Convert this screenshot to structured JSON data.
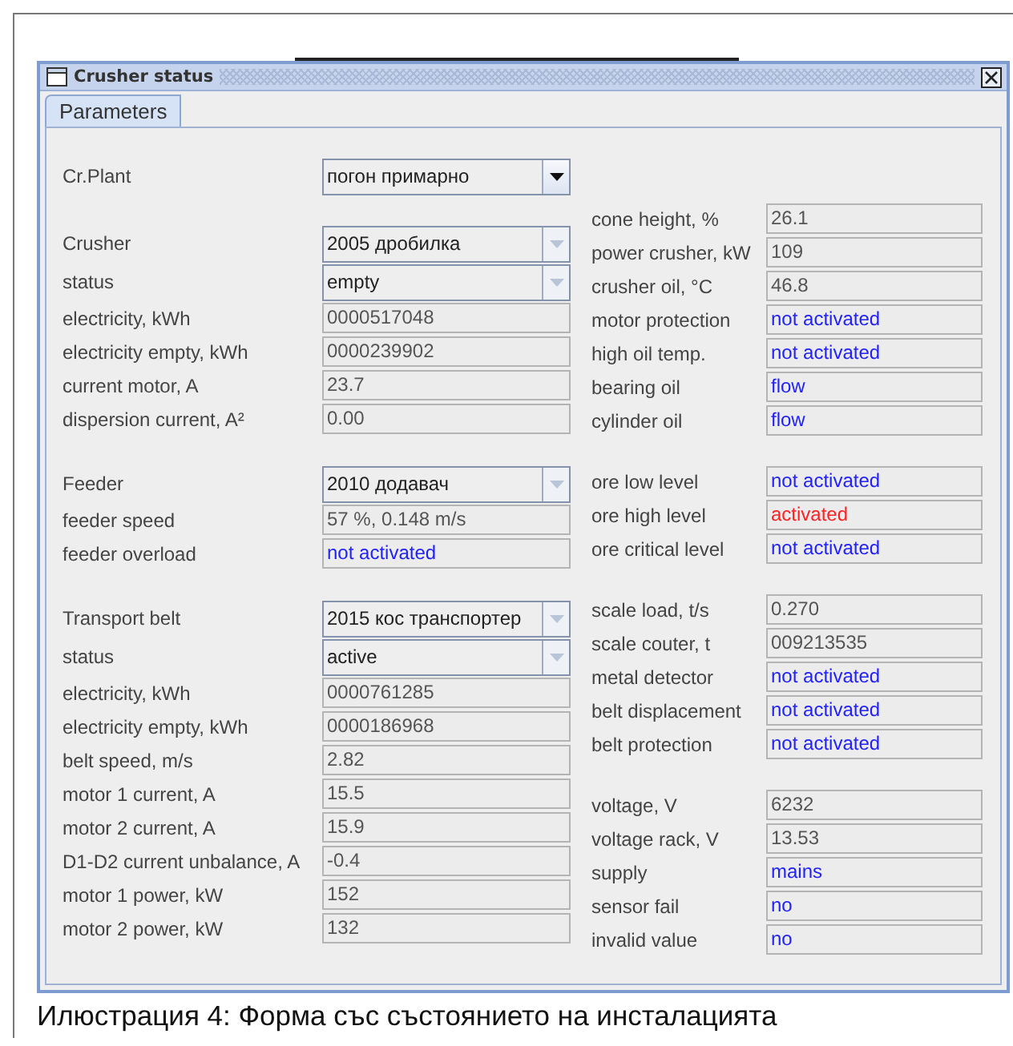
{
  "window": {
    "title": "Crusher status"
  },
  "tabs": [
    {
      "label": "Parameters",
      "selected": true
    }
  ],
  "left_column": [
    {
      "rows": [
        {
          "kind": "combo",
          "label": "Cr.Plant",
          "value": "погон примарно",
          "disabled": false
        }
      ]
    },
    {
      "rows": [
        {
          "kind": "combo",
          "label": "Crusher",
          "value": "2005 дробилка",
          "disabled": true
        },
        {
          "kind": "combo",
          "label": "status",
          "value": "empty",
          "disabled": true
        },
        {
          "kind": "field",
          "label": "electricity, kWh",
          "value": "0000517048",
          "color": "#555555"
        },
        {
          "kind": "field",
          "label": "electricity empty, kWh",
          "value": "0000239902",
          "color": "#555555"
        },
        {
          "kind": "field",
          "label": "current motor, A",
          "value": "23.7",
          "color": "#555555"
        },
        {
          "kind": "field",
          "label": "dispersion current, A²",
          "value": "0.00",
          "color": "#555555"
        }
      ]
    },
    {
      "rows": [
        {
          "kind": "combo",
          "label": "Feeder",
          "value": "2010 додавач",
          "disabled": true
        },
        {
          "kind": "field",
          "label": "feeder speed",
          "value": "57 %, 0.148 m/s",
          "color": "#555555"
        },
        {
          "kind": "field",
          "label": "feeder overload",
          "value": "not activated",
          "color": "#2222ff"
        }
      ]
    },
    {
      "rows": [
        {
          "kind": "combo",
          "label": "Transport belt",
          "value": "2015 кос транспортер",
          "disabled": true
        },
        {
          "kind": "combo",
          "label": "status",
          "value": "active",
          "disabled": true
        },
        {
          "kind": "field",
          "label": "electricity, kWh",
          "value": "0000761285",
          "color": "#555555"
        },
        {
          "kind": "field",
          "label": "electricity empty, kWh",
          "value": "0000186968",
          "color": "#555555"
        },
        {
          "kind": "field",
          "label": "belt speed, m/s",
          "value": "2.82",
          "color": "#555555"
        },
        {
          "kind": "field",
          "label": "motor 1 current, A",
          "value": "15.5",
          "color": "#555555"
        },
        {
          "kind": "field",
          "label": "motor 2 current, A",
          "value": "15.9",
          "color": "#555555"
        },
        {
          "kind": "field",
          "label": "D1-D2 current unbalance, A",
          "value": "-0.4",
          "color": "#555555"
        },
        {
          "kind": "field",
          "label": "motor 1 power, kW",
          "value": "152",
          "color": "#555555"
        },
        {
          "kind": "field",
          "label": "motor 2 power, kW",
          "value": "132",
          "color": "#555555"
        }
      ]
    }
  ],
  "right_column": [
    {
      "rows": [
        {
          "kind": "field",
          "label": "cone height, %",
          "value": "26.1",
          "color": "#555555"
        },
        {
          "kind": "field",
          "label": "power crusher, kW",
          "value": "109",
          "color": "#555555"
        },
        {
          "kind": "field",
          "label": "crusher oil, °C",
          "value": "46.8",
          "color": "#555555"
        },
        {
          "kind": "field",
          "label": "motor protection",
          "value": "not activated",
          "color": "#2222ff"
        },
        {
          "kind": "field",
          "label": "high oil temp.",
          "value": "not activated",
          "color": "#2222ff"
        },
        {
          "kind": "field",
          "label": "bearing oil",
          "value": "flow",
          "color": "#2222ff"
        },
        {
          "kind": "field",
          "label": "cylinder oil",
          "value": "flow",
          "color": "#2222ff"
        }
      ]
    },
    {
      "rows": [
        {
          "kind": "field",
          "label": "ore low level",
          "value": "not activated",
          "color": "#2222ff"
        },
        {
          "kind": "field",
          "label": "ore high level",
          "value": "activated",
          "color": "#ff2222"
        },
        {
          "kind": "field",
          "label": "ore critical level",
          "value": "not activated",
          "color": "#2222ff"
        }
      ]
    },
    {
      "rows": [
        {
          "kind": "field",
          "label": "scale load, t/s",
          "value": "0.270",
          "color": "#555555"
        },
        {
          "kind": "field",
          "label": "scale couter, t",
          "value": "009213535",
          "color": "#555555"
        },
        {
          "kind": "field",
          "label": "metal detector",
          "value": "not activated",
          "color": "#2222ff"
        },
        {
          "kind": "field",
          "label": "belt displacement",
          "value": "not activated",
          "color": "#2222ff"
        },
        {
          "kind": "field",
          "label": "belt protection",
          "value": "not activated",
          "color": "#2222ff"
        }
      ]
    },
    {
      "rows": [
        {
          "kind": "field",
          "label": "voltage, V",
          "value": "6232",
          "color": "#555555"
        },
        {
          "kind": "field",
          "label": "voltage rack, V",
          "value": "13.53",
          "color": "#555555"
        },
        {
          "kind": "field",
          "label": "supply",
          "value": "mains",
          "color": "#2222ff"
        },
        {
          "kind": "field",
          "label": "sensor fail",
          "value": "no",
          "color": "#2222ff"
        },
        {
          "kind": "field",
          "label": "invalid value",
          "value": "no",
          "color": "#2222ff"
        }
      ]
    }
  ],
  "caption": "Илюстрация 4: Форма със състоянието на инсталацията"
}
